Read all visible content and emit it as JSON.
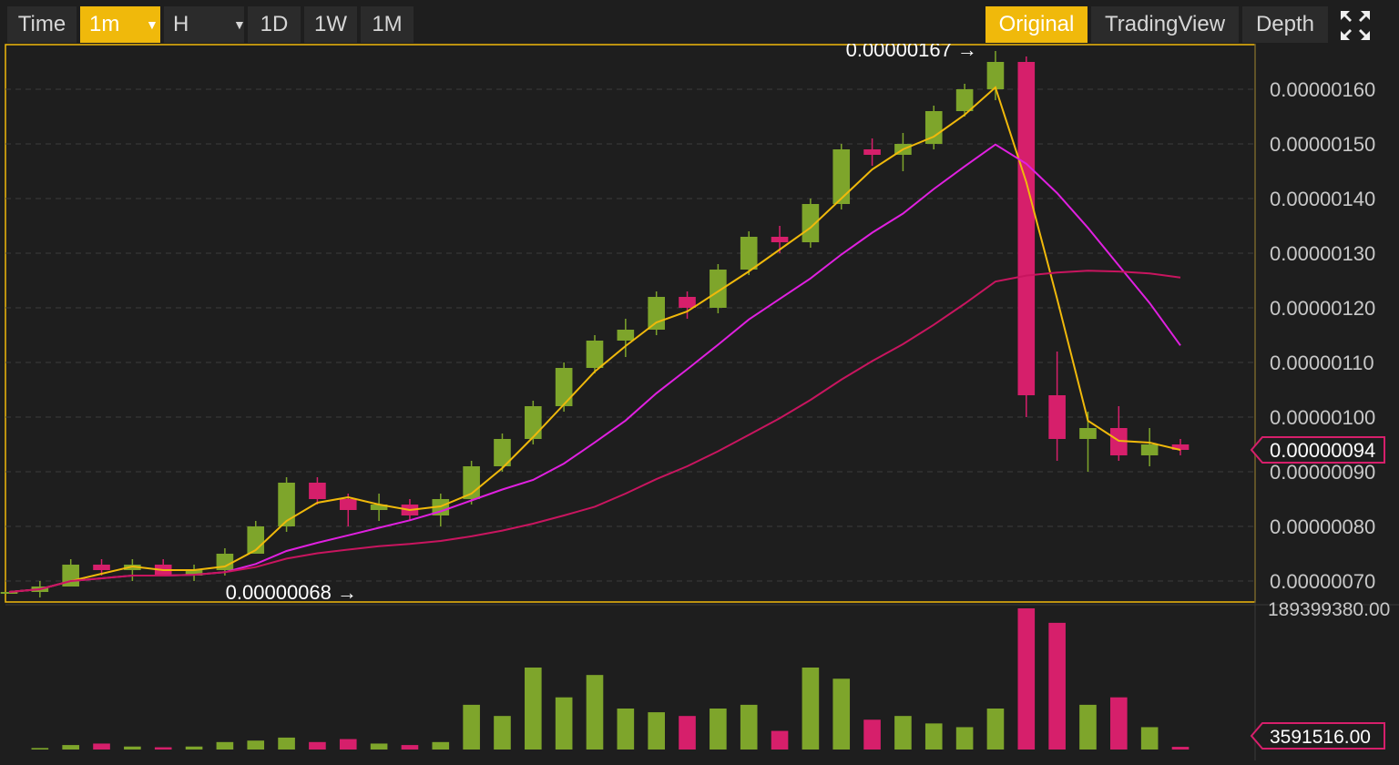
{
  "toolbar": {
    "time_label": "Time",
    "interval_label": "1m",
    "hour_label": "H",
    "day_label": "1D",
    "week_label": "1W",
    "month_label": "1M",
    "original_label": "Original",
    "tradingview_label": "TradingView",
    "depth_label": "Depth"
  },
  "icons": {
    "fullscreen": "fullscreen-icon",
    "dropdown": "caret-down-icon"
  },
  "colors": {
    "background": "#1e1e1e",
    "accent": "#f0b90b",
    "up": "#7ea52b",
    "down": "#d61f6b",
    "ma_short": "#f0b90b",
    "ma_mid": "#e020e0",
    "ma_long": "#c8155f"
  },
  "price_axis": {
    "ticks": [
      "0.00000160",
      "0.00000150",
      "0.00000140",
      "0.00000130",
      "0.00000120",
      "0.00000110",
      "0.00000100",
      "0.00000090",
      "0.00000080",
      "0.00000070"
    ],
    "current_price": "0.00000094",
    "high_label": "0.00000167",
    "low_label": "0.00000068"
  },
  "volume_axis": {
    "max_label": "189399380.00",
    "current_label": "3591516.00"
  },
  "chart_data": {
    "type": "line",
    "price_range": [
      6.8e-07,
      1.67e-06
    ],
    "ylim": [
      6.5e-07,
      1.7e-06
    ],
    "volume_max": 189399380,
    "candles": [
      [
        6.8e-07,
        6.8e-07,
        6.8e-07,
        6.8e-07,
        0
      ],
      [
        6.8e-07,
        7e-07,
        6.7e-07,
        6.9e-07,
        2000000
      ],
      [
        6.9e-07,
        7.4e-07,
        6.9e-07,
        7.3e-07,
        6000000
      ],
      [
        7.3e-07,
        7.4e-07,
        7.1e-07,
        7.2e-07,
        8000000
      ],
      [
        7.2e-07,
        7.4e-07,
        7e-07,
        7.3e-07,
        4000000
      ],
      [
        7.3e-07,
        7.4e-07,
        7.1e-07,
        7.1e-07,
        3000000
      ],
      [
        7.1e-07,
        7.3e-07,
        7e-07,
        7.2e-07,
        4000000
      ],
      [
        7.2e-07,
        7.6e-07,
        7.1e-07,
        7.5e-07,
        10000000
      ],
      [
        7.5e-07,
        8.1e-07,
        7.5e-07,
        8e-07,
        12000000
      ],
      [
        8e-07,
        8.9e-07,
        7.9e-07,
        8.8e-07,
        16000000
      ],
      [
        8.8e-07,
        8.9e-07,
        8.4e-07,
        8.5e-07,
        10000000
      ],
      [
        8.5e-07,
        8.6e-07,
        8e-07,
        8.3e-07,
        14000000
      ],
      [
        8.3e-07,
        8.6e-07,
        8.1e-07,
        8.4e-07,
        8000000
      ],
      [
        8.4e-07,
        8.5e-07,
        8.1e-07,
        8.2e-07,
        6000000
      ],
      [
        8.2e-07,
        8.6e-07,
        8e-07,
        8.5e-07,
        10000000
      ],
      [
        8.5e-07,
        9.2e-07,
        8.4e-07,
        9.1e-07,
        60000000
      ],
      [
        9.1e-07,
        9.7e-07,
        9e-07,
        9.6e-07,
        45000000
      ],
      [
        9.6e-07,
        1.03e-06,
        9.5e-07,
        1.02e-06,
        110000000
      ],
      [
        1.02e-06,
        1.1e-06,
        1.01e-06,
        1.09e-06,
        70000000
      ],
      [
        1.09e-06,
        1.15e-06,
        1.08e-06,
        1.14e-06,
        100000000
      ],
      [
        1.14e-06,
        1.18e-06,
        1.11e-06,
        1.16e-06,
        55000000
      ],
      [
        1.16e-06,
        1.23e-06,
        1.15e-06,
        1.22e-06,
        50000000
      ],
      [
        1.22e-06,
        1.23e-06,
        1.18e-06,
        1.2e-06,
        45000000
      ],
      [
        1.2e-06,
        1.28e-06,
        1.19e-06,
        1.27e-06,
        55000000
      ],
      [
        1.27e-06,
        1.34e-06,
        1.26e-06,
        1.33e-06,
        60000000
      ],
      [
        1.33e-06,
        1.35e-06,
        1.3e-06,
        1.32e-06,
        25000000
      ],
      [
        1.32e-06,
        1.4e-06,
        1.31e-06,
        1.39e-06,
        110000000
      ],
      [
        1.39e-06,
        1.5e-06,
        1.38e-06,
        1.49e-06,
        95000000
      ],
      [
        1.49e-06,
        1.51e-06,
        1.46e-06,
        1.48e-06,
        40000000
      ],
      [
        1.48e-06,
        1.52e-06,
        1.45e-06,
        1.5e-06,
        45000000
      ],
      [
        1.5e-06,
        1.57e-06,
        1.49e-06,
        1.56e-06,
        35000000
      ],
      [
        1.56e-06,
        1.61e-06,
        1.55e-06,
        1.6e-06,
        30000000
      ],
      [
        1.6e-06,
        1.67e-06,
        1.58e-06,
        1.65e-06,
        55000000
      ],
      [
        1.65e-06,
        1.66e-06,
        1e-06,
        1.04e-06,
        189399380
      ],
      [
        1.04e-06,
        1.12e-06,
        9.2e-07,
        9.6e-07,
        170000000
      ],
      [
        9.6e-07,
        1.01e-06,
        9e-07,
        9.8e-07,
        60000000
      ],
      [
        9.8e-07,
        1.02e-06,
        9.2e-07,
        9.3e-07,
        70000000
      ],
      [
        9.3e-07,
        9.8e-07,
        9.1e-07,
        9.5e-07,
        30000000
      ],
      [
        9.5e-07,
        9.6e-07,
        9.3e-07,
        9.4e-07,
        3591516
      ]
    ]
  }
}
